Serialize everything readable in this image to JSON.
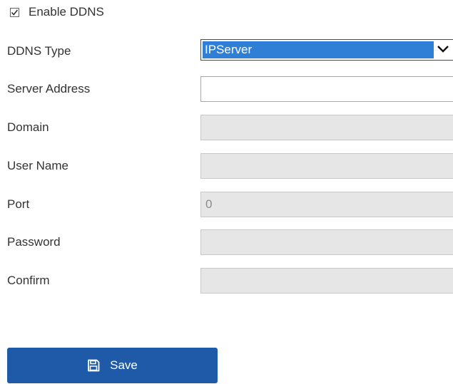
{
  "enable_ddns": {
    "label": "Enable DDNS",
    "checked": true
  },
  "form": {
    "ddns_type": {
      "label": "DDNS Type",
      "selected": "IPServer"
    },
    "server_address": {
      "label": "Server Address",
      "value": ""
    },
    "domain": {
      "label": "Domain",
      "value": ""
    },
    "user_name": {
      "label": "User Name",
      "value": ""
    },
    "port": {
      "label": "Port",
      "value": "0"
    },
    "password": {
      "label": "Password",
      "value": ""
    },
    "confirm": {
      "label": "Confirm",
      "value": ""
    }
  },
  "save_button": {
    "label": "Save",
    "icon": "save-icon"
  },
  "colors": {
    "select_highlight": "#2f7fd6",
    "button_bg": "#1e5aa8",
    "disabled_field": "#e6e6e6"
  }
}
